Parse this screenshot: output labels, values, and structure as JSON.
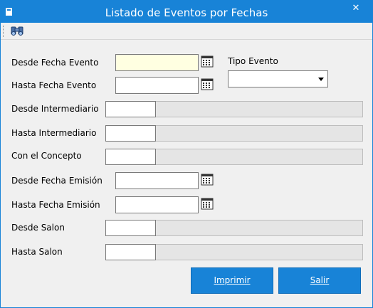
{
  "window": {
    "title": "Listado de Eventos por Fechas",
    "close_glyph": "✕"
  },
  "toolbar": {
    "icons": [
      "binoculars-icon"
    ]
  },
  "form": {
    "desde_fecha_evento": {
      "label": "Desde Fecha Evento",
      "value": ""
    },
    "hasta_fecha_evento": {
      "label": "Hasta Fecha Evento",
      "value": ""
    },
    "tipo_evento": {
      "label": "Tipo Evento",
      "value": ""
    },
    "desde_intermediario": {
      "label": "Desde Intermediario",
      "code": "",
      "description": ""
    },
    "hasta_intermediario": {
      "label": "Hasta Intermediario",
      "code": "",
      "description": ""
    },
    "con_el_concepto": {
      "label": "Con el Concepto",
      "code": "",
      "description": ""
    },
    "desde_fecha_emision": {
      "label": "Desde Fecha Emisión",
      "value": ""
    },
    "hasta_fecha_emision": {
      "label": "Hasta Fecha Emisión",
      "value": ""
    },
    "desde_salon": {
      "label": "Desde Salon",
      "code": "",
      "description": ""
    },
    "hasta_salon": {
      "label": "Hasta Salon",
      "code": "",
      "description": ""
    }
  },
  "buttons": {
    "imprimir": "Imprimir",
    "salir": "Salir"
  },
  "colors": {
    "titlebar": "#1883d7",
    "button": "#1883d7",
    "focused_field": "#ffffe1",
    "readonly_field": "#e5e5e5"
  }
}
